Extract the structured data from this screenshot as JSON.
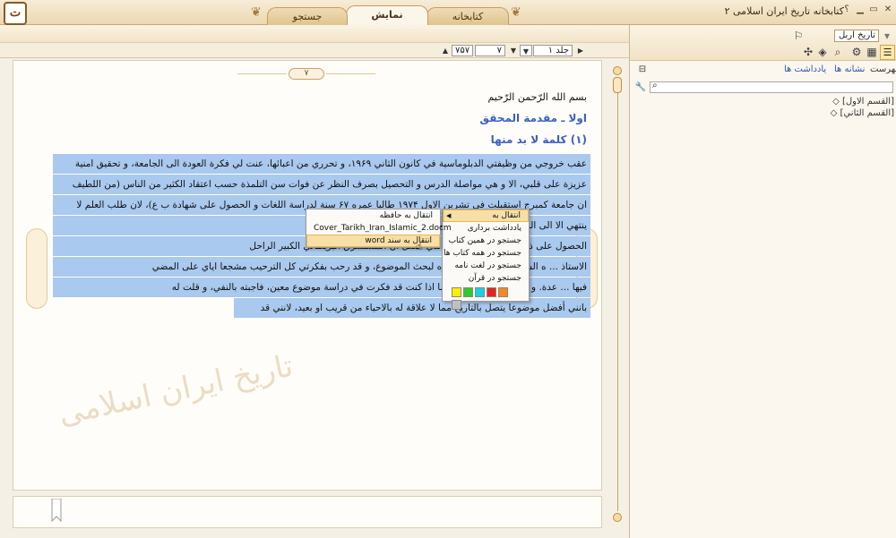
{
  "app": {
    "title": "کتابخانه تاریخ ایران اسلامی ۲",
    "logo_letter": "ت",
    "window_buttons": {
      "close": "✕",
      "maximize": "▭",
      "minimize": "▁",
      "help": "؟"
    }
  },
  "tabs": [
    {
      "label": "کتابخانه",
      "active": false
    },
    {
      "label": "نمایش",
      "active": true
    },
    {
      "label": "جستجو",
      "active": false
    }
  ],
  "nav": {
    "volume_label": "جلد ۱",
    "page_number": "۷",
    "total_pages": "۷۵۷"
  },
  "document": {
    "page_badge": "۷",
    "basmala": "بسم الله الرّحمن الرّحيم",
    "heading1": "اولا ـ مقدمة المحقق",
    "heading2": "(۱) كلمة لا بد منها",
    "lines": [
      "عقب خروجي من وظيفتي الدبلوماسية في كانون الثاني ۱۹۶۹، و تحرري من اعبائها، عنت لي فكرة العودة الى الجامعة، و تحقيق امنية",
      "عزيزة على قلبي، الا و هي مواصلة الدرس و التحصيل بصرف النظر عن فوات سن التلمذة حسب اعتقاد الكثير من الناس (من اللطيف",
      "ان جامعة كمبرج استقبلت في تشرين الاول ۱۹۷۴ طالبا عمره ۶۷ سنة لدراسة اللغات و الحصول على شهادة ب ع)، لان طلب العلم لا",
      "ينتهي الا الى اللحد». و لذا فانني قصدت بريطانيا للتعرف على امكانيات",
      "الحصول على ذلك ... اختار كمبرج. و الذي حصل ان المستشرق البريطاني الكبير الراحل",
      "الاستاذ ... ه الشديد باستقبالي في داره لبحث الموضوع، و قد رحب بفكرتي كل الترحيب مشجعا اياي على المضي",
      "فيها ... عدة. و اثناء الحديث سألني عما اذا كنت قد فكرت في دراسة موضوع معين، فاجبته بالنفي، و قلت له",
      "بانني أفضل موضوعا يتصل بالتاريخ مما لا علاقة له بالاحياء من قريب او بعيد، لانني قد"
    ],
    "watermark": "تاریخ ایران اسلامی"
  },
  "context_menu": {
    "items": [
      {
        "label": "انتقال به",
        "highlight": true,
        "submenu": true
      },
      {
        "label": "یادداشت برداری"
      },
      {
        "label": "جستجو در همین کتاب"
      },
      {
        "label": "جستجو در همه کتاب ها"
      },
      {
        "label": "جستجو در لغت نامه"
      },
      {
        "label": "جستجو در قرآن"
      }
    ],
    "swatch_colors": [
      "#c0c0c0",
      "#f5891f",
      "#e8231c",
      "#18d1e4",
      "#2fcb2a",
      "#ffee00"
    ]
  },
  "submenu": {
    "items": [
      {
        "label": "انتقال به حافظه"
      },
      {
        "label": "Cover_Tarikh_Iran_Islamic_2.docm"
      },
      {
        "label": "انتقال به سند word",
        "highlight": true
      }
    ]
  },
  "right_panel": {
    "book_select": "تاریخ اربل",
    "tabs": {
      "index": "فهرست",
      "bookmarks": "نشانه ها",
      "notes": "یادداشت ها"
    },
    "tree": [
      "[القسم الاول]",
      "[القسم الثاني]"
    ]
  },
  "colors": {
    "selection": "#a9c9ee",
    "heading": "#3a5fc8",
    "accent": "#c59d60"
  }
}
